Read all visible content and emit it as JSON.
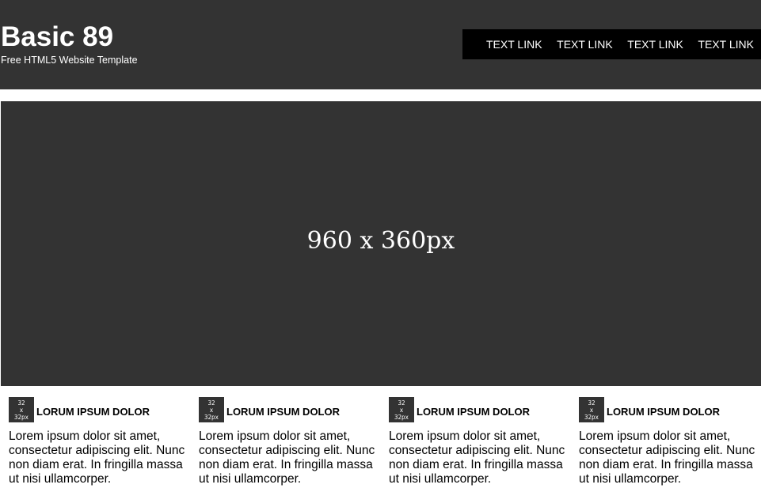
{
  "header": {
    "title": "Basic 89",
    "tagline": "Free HTML5 Website Template",
    "nav": [
      {
        "label": "TEXT LINK"
      },
      {
        "label": "TEXT LINK"
      },
      {
        "label": "TEXT LINK"
      },
      {
        "label": "TEXT LINK"
      }
    ]
  },
  "hero": {
    "placeholder_text": "960 x 360px"
  },
  "features": [
    {
      "thumb_lines": [
        "32",
        "x",
        "32px"
      ],
      "title": "LORUM IPSUM DOLOR",
      "body": "Lorem ipsum dolor sit amet, consectetur adipiscing elit. Nunc non diam erat. In fringilla massa ut nisi ullamcorper."
    },
    {
      "thumb_lines": [
        "32",
        "x",
        "32px"
      ],
      "title": "LORUM IPSUM DOLOR",
      "body": "Lorem ipsum dolor sit amet, consectetur adipiscing elit. Nunc non diam erat. In fringilla massa ut nisi ullamcorper."
    },
    {
      "thumb_lines": [
        "32",
        "x",
        "32px"
      ],
      "title": "LORUM IPSUM DOLOR",
      "body": "Lorem ipsum dolor sit amet, consectetur adipiscing elit. Nunc non diam erat. In fringilla massa ut nisi ullamcorper."
    },
    {
      "thumb_lines": [
        "32",
        "x",
        "32px"
      ],
      "title": "LORUM IPSUM DOLOR",
      "body": "Lorem ipsum dolor sit amet, consectetur adipiscing elit. Nunc non diam erat. In fringilla massa ut nisi ullamcorper."
    }
  ],
  "colors": {
    "header_bg": "#333333",
    "nav_bg": "#000000",
    "hero_bg": "#333333",
    "text_light": "#ffffff",
    "text_dark": "#000000"
  }
}
